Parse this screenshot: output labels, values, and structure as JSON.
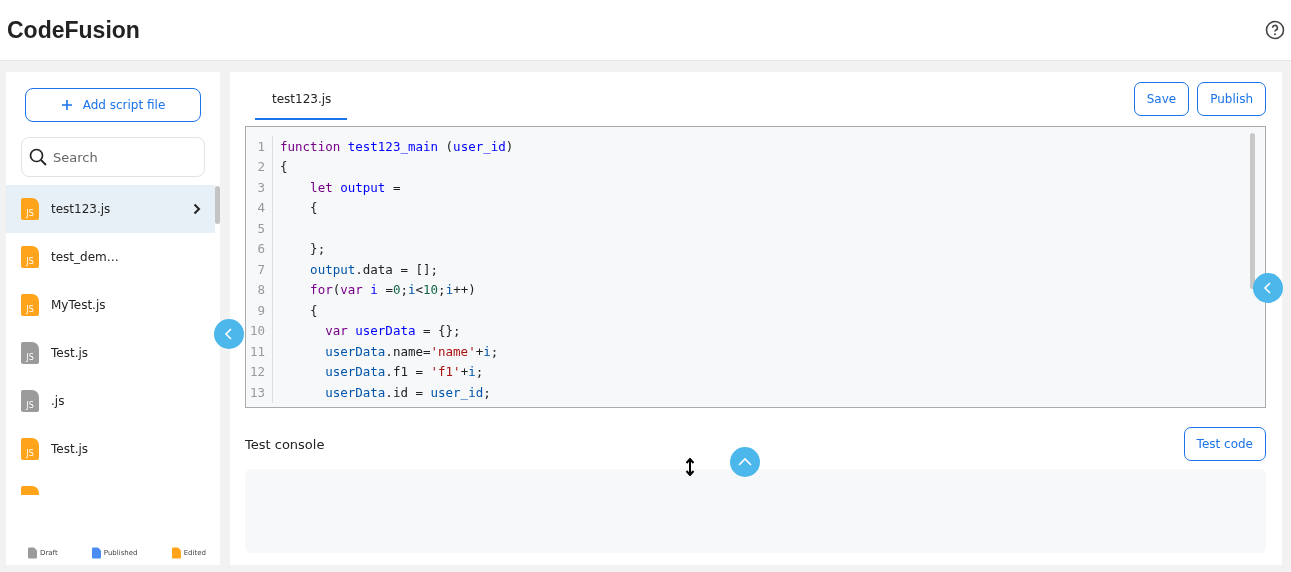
{
  "app": {
    "title": "CodeFusion"
  },
  "sidebar": {
    "add_button": "Add script file",
    "search": {
      "placeholder": "Search"
    },
    "files": [
      {
        "name": "test123.js",
        "badge": "JS",
        "color": "#ffa41b",
        "selected": true
      },
      {
        "name": "test_dem…",
        "badge": "JS",
        "color": "#ffa41b",
        "selected": false
      },
      {
        "name": "MyTest.js",
        "badge": "JS",
        "color": "#ffa41b",
        "selected": false
      },
      {
        "name": "Test.js",
        "badge": "JS",
        "color": "#9b9b9b",
        "selected": false
      },
      {
        "name": ".js",
        "badge": "JS",
        "color": "#9b9b9b",
        "selected": false
      },
      {
        "name": "Test.js",
        "badge": "JS",
        "color": "#ffa41b",
        "selected": false
      },
      {
        "color": "#ffa41b",
        "selected": false
      }
    ],
    "legend": [
      {
        "color": "#9b9b9b",
        "label": "Draft"
      },
      {
        "color": "#4a8cf0",
        "label": "Published"
      },
      {
        "color": "#ffa41b",
        "label": "Edited"
      }
    ]
  },
  "editor": {
    "tabs": [
      {
        "label": "test123.js",
        "selected": true
      }
    ],
    "buttons": [
      "Save",
      "Publish"
    ],
    "lines": [
      {
        "number": "1",
        "tokens": [
          {
            "kind": "keyword",
            "text": "function "
          },
          {
            "kind": "def",
            "text": "test123_main"
          },
          {
            "kind": "plain",
            "text": " ("
          },
          {
            "kind": "def",
            "text": "user_id"
          },
          {
            "kind": "plain",
            "text": ")"
          }
        ]
      },
      {
        "number": "2",
        "tokens": [
          {
            "kind": "plain",
            "text": "{"
          }
        ]
      },
      {
        "number": "3",
        "tokens": [
          {
            "kind": "keyword",
            "text": "    let "
          },
          {
            "kind": "def",
            "text": "output"
          },
          {
            "kind": "plain",
            "text": " ="
          }
        ]
      },
      {
        "number": "4",
        "tokens": [
          {
            "kind": "plain",
            "text": "    {"
          }
        ]
      },
      {
        "number": "5"
      },
      {
        "number": "6",
        "tokens": [
          {
            "kind": "plain",
            "text": "    };"
          }
        ]
      },
      {
        "number": "7",
        "tokens": [
          {
            "kind": "variable",
            "text": "    output"
          },
          {
            "kind": "plain",
            "text": ".data = [];"
          }
        ]
      },
      {
        "number": "8",
        "tokens": [
          {
            "kind": "keyword",
            "text": "    for"
          },
          {
            "kind": "plain",
            "text": "("
          },
          {
            "kind": "keyword",
            "text": "var "
          },
          {
            "kind": "def",
            "text": "i"
          },
          {
            "kind": "plain",
            "text": " ="
          },
          {
            "kind": "number",
            "text": "0"
          },
          {
            "kind": "plain",
            "text": ";"
          },
          {
            "kind": "variable",
            "text": "i"
          },
          {
            "kind": "plain",
            "text": "<"
          },
          {
            "kind": "number",
            "text": "10"
          },
          {
            "kind": "plain",
            "text": ";"
          },
          {
            "kind": "variable",
            "text": "i"
          },
          {
            "kind": "plain",
            "text": "++)"
          }
        ]
      },
      {
        "number": "9",
        "tokens": [
          {
            "kind": "plain",
            "text": "    {"
          }
        ]
      },
      {
        "number": "10",
        "tokens": [
          {
            "kind": "keyword",
            "text": "      var "
          },
          {
            "kind": "def",
            "text": "userData"
          },
          {
            "kind": "plain",
            "text": " = {};"
          }
        ]
      },
      {
        "number": "11",
        "tokens": [
          {
            "kind": "variable",
            "text": "      userData"
          },
          {
            "kind": "plain",
            "text": ".name="
          },
          {
            "kind": "string",
            "text": "'name'"
          },
          {
            "kind": "plain",
            "text": "+"
          },
          {
            "kind": "variable",
            "text": "i"
          },
          {
            "kind": "plain",
            "text": ";"
          }
        ]
      },
      {
        "number": "12",
        "tokens": [
          {
            "kind": "variable",
            "text": "      userData"
          },
          {
            "kind": "plain",
            "text": ".f1 = "
          },
          {
            "kind": "string",
            "text": "'f1'"
          },
          {
            "kind": "plain",
            "text": "+"
          },
          {
            "kind": "variable",
            "text": "i"
          },
          {
            "kind": "plain",
            "text": ";"
          }
        ]
      },
      {
        "number": "13",
        "tokens": [
          {
            "kind": "variable",
            "text": "      userData"
          },
          {
            "kind": "plain",
            "text": ".id = "
          },
          {
            "kind": "variable",
            "text": "user_id"
          },
          {
            "kind": "plain",
            "text": ";"
          }
        ]
      }
    ]
  },
  "console": {
    "title": "Test console",
    "button": "Test code"
  }
}
